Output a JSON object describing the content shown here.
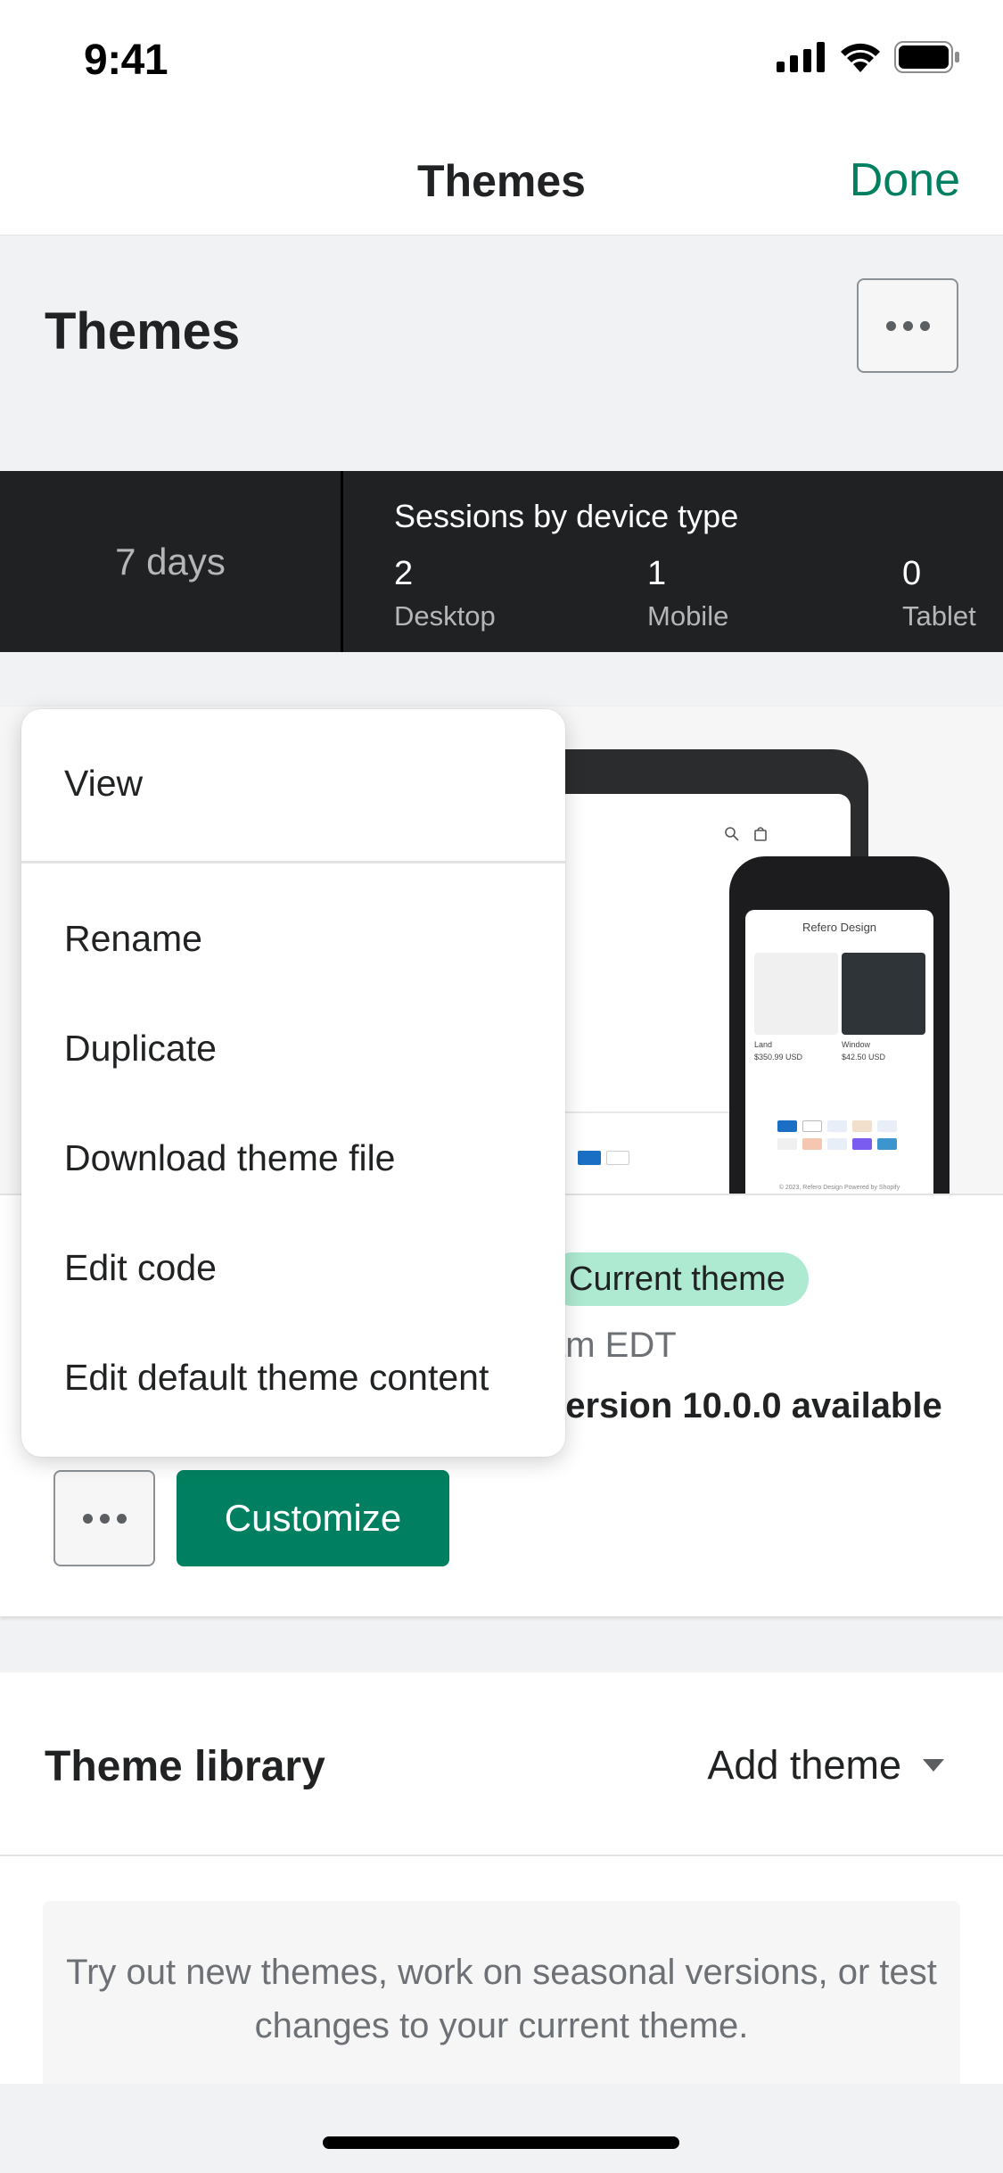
{
  "status": {
    "time": "9:41"
  },
  "nav": {
    "title": "Themes",
    "done": "Done"
  },
  "header": {
    "title": "Themes"
  },
  "sessions": {
    "period": "7 days",
    "title": "Sessions by device type",
    "metrics": [
      {
        "value": "2",
        "label": "Desktop"
      },
      {
        "value": "1",
        "label": "Mobile"
      },
      {
        "value": "0",
        "label": "Tablet"
      }
    ]
  },
  "preview": {
    "phone_brand": "Refero Design",
    "product_a_name": "Land",
    "product_a_price": "$350.99 USD",
    "product_b_name": "Window",
    "product_b_price": "$42.50 USD",
    "footer": "© 2023, Refero Design Powered by Shopify"
  },
  "current_theme": {
    "badge": "Current theme",
    "meta": "am EDT",
    "update": "version 10.0.0 available",
    "customize_label": "Customize"
  },
  "menu": {
    "items": [
      "View",
      "Rename",
      "Duplicate",
      "Download theme file",
      "Edit code",
      "Edit default theme content"
    ]
  },
  "library": {
    "title": "Theme library",
    "add_theme": "Add theme",
    "empty_text": "Try out new themes, work on seasonal versions, or test changes to your current theme."
  },
  "colors": {
    "accent": "#008060",
    "badge_bg": "#aee9d1",
    "dark_panel": "#202123"
  },
  "icons": [
    "signal-icon",
    "wifi-icon",
    "battery-icon",
    "more-icon",
    "chevron-down-icon",
    "search-icon",
    "cart-icon"
  ]
}
